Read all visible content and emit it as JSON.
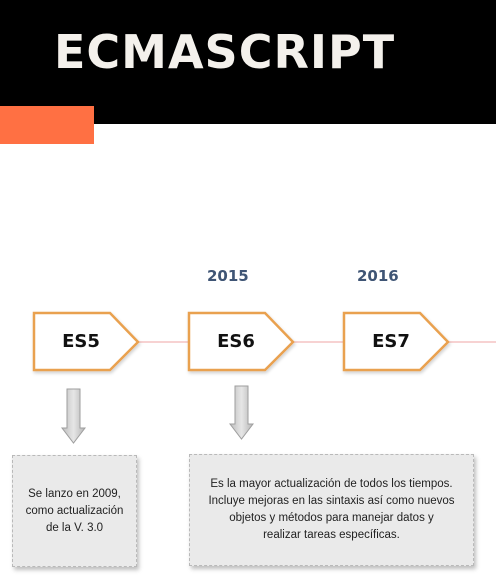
{
  "header": {
    "title": "ECMASCRIPT"
  },
  "timeline": {
    "years": [
      "2015",
      "2016"
    ],
    "versions": [
      "ES5",
      "ES6",
      "ES7"
    ]
  },
  "notes": {
    "es5": [
      "Se lanzo en 2009,",
      "como actualización",
      "de  la V. 3.0"
    ],
    "es6": [
      "Es la mayor actualización de todos los tiempos.",
      "Incluye mejoras en las sintaxis así como nuevos",
      "objetos y métodos para manejar datos y",
      "realizar tareas específicas."
    ]
  },
  "colors": {
    "header_bg": "#000000",
    "accent": "#ff7043",
    "node_border": "#e9a150",
    "connector": "#f2b6b6",
    "year_text": "#3f5575",
    "note_bg": "#eaeaea"
  }
}
